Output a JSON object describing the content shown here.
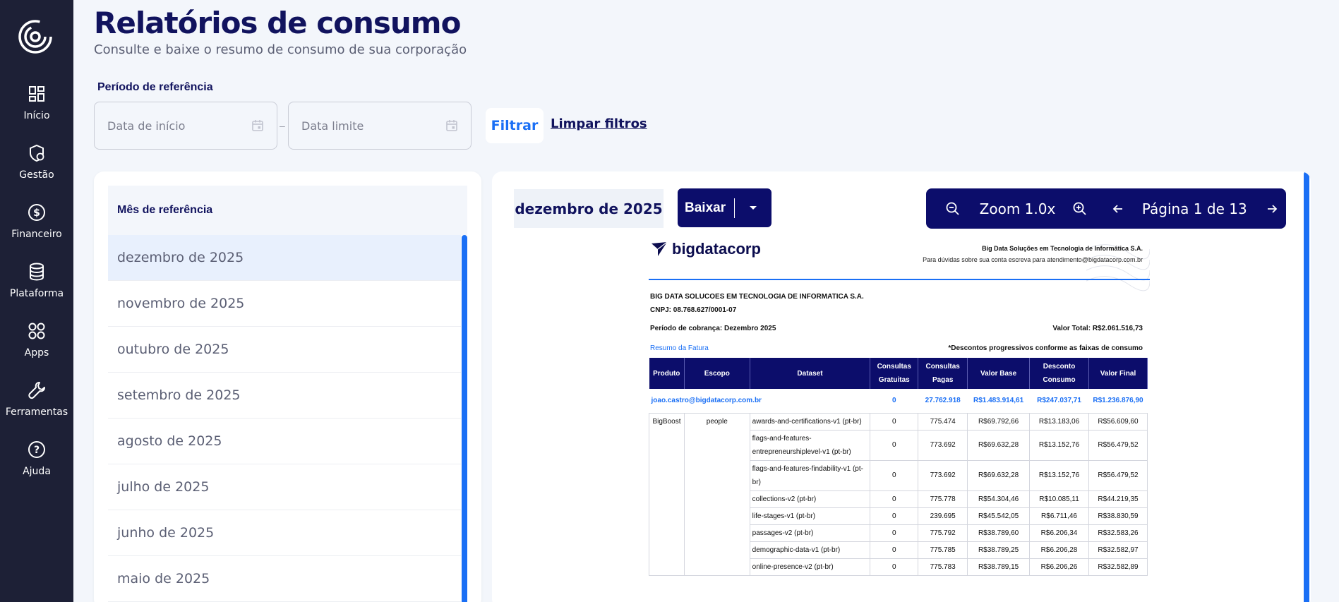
{
  "sidebar": {
    "items": [
      {
        "label": "Início",
        "icon": "dashboard-icon"
      },
      {
        "label": "Gestão",
        "icon": "shield-icon"
      },
      {
        "label": "Financeiro",
        "icon": "dollar-icon"
      },
      {
        "label": "Plataforma",
        "icon": "database-icon"
      },
      {
        "label": "Apps",
        "icon": "apps-icon"
      },
      {
        "label": "Ferramentas",
        "icon": "wrench-icon"
      },
      {
        "label": "Ajuda",
        "icon": "help-icon"
      }
    ]
  },
  "header": {
    "title": "Relatórios de consumo",
    "subtitle": "Consulte e baixe o resumo de consumo de sua corporação"
  },
  "filters": {
    "period_label": "Período de referência",
    "start_placeholder": "Data de início",
    "end_placeholder": "Data limite",
    "separator": "–",
    "filter_label": "Filtrar",
    "clear_label": "Limpar filtros"
  },
  "months": {
    "header": "Mês de referência",
    "items": [
      "dezembro de 2025",
      "novembro de 2025",
      "outubro de 2025",
      "setembro de 2025",
      "agosto de 2025",
      "julho de 2025",
      "junho de 2025",
      "maio de 2025"
    ],
    "active_index": 0
  },
  "viewer": {
    "selected_month": "dezembro de 2025",
    "download_label": "Baixar",
    "zoom_label": "Zoom 1.0x",
    "page_label": "Página 1 de 13"
  },
  "document": {
    "brand": "bigdatacorp",
    "company_right": "Big Data Soluções em Tecnologia de Informática S.A.",
    "contact": "Para dúvidas sobre sua conta escreva para atendimento@bigdatacorp.com.br",
    "company_name": "BIG DATA SOLUCOES EM TECNOLOGIA DE INFORMATICA S.A.",
    "cnpj": "CNPJ: 08.768.627/0001-07",
    "period": "Período de cobrança: Dezembro 2025",
    "total": "Valor Total: R$2.061.516,73",
    "summary_label": "Resumo da Fatura",
    "discount_note": "*Descontos progressivos conforme as faixas de consumo",
    "columns": [
      "Produto",
      "Escopo",
      "Dataset",
      "Consultas Gratuitas",
      "Consultas Pagas",
      "Valor Base",
      "Desconto Consumo",
      "Valor Final"
    ],
    "user_row": {
      "email": "joao.castro@bigdatacorp.com.br",
      "free": "0",
      "paid": "27.762.918",
      "base": "R$1.483.914,61",
      "discount": "R$247.037,71",
      "final": "R$1.236.876,90"
    },
    "product": "BigBoost",
    "scope": "people",
    "rows": [
      {
        "dataset": "awards-and-certifications-v1 (pt-br)",
        "free": "0",
        "paid": "775.474",
        "base": "R$69.792,66",
        "discount": "R$13.183,06",
        "final": "R$56.609,60"
      },
      {
        "dataset": "flags-and-features-entrepreneurshiplevel-v1 (pt-br)",
        "free": "0",
        "paid": "773.692",
        "base": "R$69.632,28",
        "discount": "R$13.152,76",
        "final": "R$56.479,52"
      },
      {
        "dataset": "flags-and-features-findability-v1 (pt-br)",
        "free": "0",
        "paid": "773.692",
        "base": "R$69.632,28",
        "discount": "R$13.152,76",
        "final": "R$56.479,52"
      },
      {
        "dataset": "collections-v2 (pt-br)",
        "free": "0",
        "paid": "775.778",
        "base": "R$54.304,46",
        "discount": "R$10.085,11",
        "final": "R$44.219,35"
      },
      {
        "dataset": "life-stages-v1 (pt-br)",
        "free": "0",
        "paid": "239.695",
        "base": "R$45.542,05",
        "discount": "R$6.711,46",
        "final": "R$38.830,59"
      },
      {
        "dataset": "passages-v2 (pt-br)",
        "free": "0",
        "paid": "775.792",
        "base": "R$38.789,60",
        "discount": "R$6.206,34",
        "final": "R$32.583,26"
      },
      {
        "dataset": "demographic-data-v1 (pt-br)",
        "free": "0",
        "paid": "775.785",
        "base": "R$38.789,25",
        "discount": "R$6.206,28",
        "final": "R$32.582,97"
      },
      {
        "dataset": "online-presence-v2 (pt-br)",
        "free": "0",
        "paid": "775.783",
        "base": "R$38.789,15",
        "discount": "R$6.206,26",
        "final": "R$32.582,89"
      }
    ]
  },
  "colors": {
    "sidebar_bg": "#1d2036",
    "navy": "#0c0d6b",
    "accent_blue": "#1a6ff5",
    "page_bg": "#f3f6fb"
  }
}
